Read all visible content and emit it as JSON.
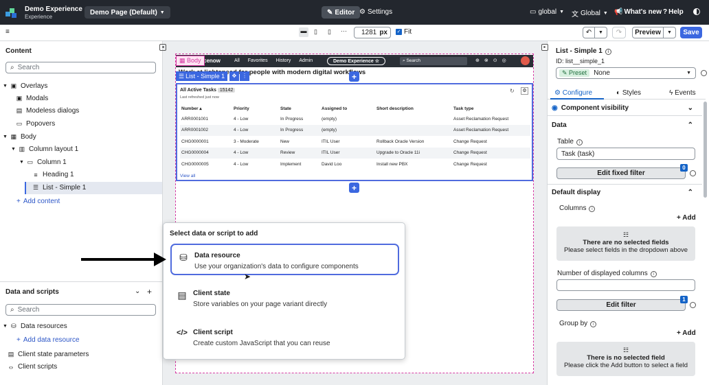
{
  "app": {
    "title": "Demo Experience",
    "subtitle": "Experience",
    "page_select": "Demo Page (Default)",
    "editor_label": "Editor",
    "settings_label": "Settings",
    "scope1": "global",
    "scope2": "Global",
    "whats_new": "What's new",
    "help": "Help"
  },
  "toolbar": {
    "width_value": "1281",
    "unit": "px",
    "fit_label": "Fit",
    "preview_label": "Preview",
    "save_label": "Save",
    "more": "···"
  },
  "content": {
    "title": "Content",
    "search_placeholder": "Search",
    "items": [
      "Overlays",
      "Modals",
      "Modeless dialogs",
      "Popovers",
      "Body",
      "Column layout 1",
      "Column 1",
      "Heading 1",
      "List - Simple 1"
    ],
    "add_content": "Add content"
  },
  "data_scripts": {
    "title": "Data and scripts",
    "search_placeholder": "Search",
    "data_resources": "Data resources",
    "add_data_resource": "Add data resource",
    "client_state": "Client state parameters",
    "client_scripts": "Client scripts"
  },
  "canvas": {
    "body_tag": "Body",
    "list_tag": "List - Simple 1",
    "logo_text": "cenow",
    "nav": [
      "All",
      "Favorites",
      "History",
      "Admin"
    ],
    "experience_pill": "Demo Experience ☆",
    "search_label": "Search",
    "heading": "Work at lightspeed for people with modern digital workflows",
    "list_title": "All Active Tasks",
    "list_count": "15142",
    "last_refreshed": "Last refreshed just now",
    "columns": [
      "Number ▴",
      "Priority",
      "State",
      "Assigned to",
      "Short description",
      "Task type"
    ],
    "rows": [
      [
        "ARR0001001",
        "4 - Low",
        "In Progress",
        "(empty)",
        "",
        "Asset Reclamation Request"
      ],
      [
        "ARR0001002",
        "4 - Low",
        "In Progress",
        "(empty)",
        "",
        "Asset Reclamation Request"
      ],
      [
        "CHG0000001",
        "3 - Moderate",
        "New",
        "ITIL User",
        "Rollback Oracle Version",
        "Change Request"
      ],
      [
        "CHG0000004",
        "4 - Low",
        "Review",
        "ITIL User",
        "Upgrade to Oracle 11i",
        "Change Request"
      ],
      [
        "CHG0000005",
        "4 - Low",
        "Implement",
        "David Loo",
        "Install new PBX",
        "Change Request"
      ]
    ],
    "view_all": "View all"
  },
  "popup": {
    "title": "Select data or script to add",
    "options": [
      {
        "title": "Data resource",
        "desc": "Use your organization's data to configure components"
      },
      {
        "title": "Client state",
        "desc": "Store variables on your page variant directly"
      },
      {
        "title": "Client script",
        "desc": "Create custom JavaScript that you can reuse"
      }
    ]
  },
  "config": {
    "title": "List - Simple 1",
    "id": "ID: list__simple_1",
    "preset_label": "Preset",
    "preset_value": "None",
    "tabs": [
      "Configure",
      "Styles",
      "Events"
    ],
    "component_visibility": "Component visibility",
    "data_section": "Data",
    "table_label": "Table",
    "table_value": "Task (task)",
    "edit_fixed_filter": "Edit fixed filter",
    "fixed_filter_count": "0",
    "default_display": "Default display",
    "columns_label": "Columns",
    "add": "Add",
    "no_fields_title": "There are no selected fields",
    "no_fields_desc": "Please select fields in the dropdown above",
    "displayed_columns_label": "Number of displayed columns",
    "edit_filter": "Edit filter",
    "filter_count": "1",
    "group_by_label": "Group by",
    "no_field_title": "There is no selected field",
    "no_field_desc": "Please click the Add button to select a field"
  },
  "colors": {
    "accent": "#3b67e0",
    "topbar": "#23272e",
    "selection": "#4f6bde",
    "body_tag": "#d63aa3"
  }
}
